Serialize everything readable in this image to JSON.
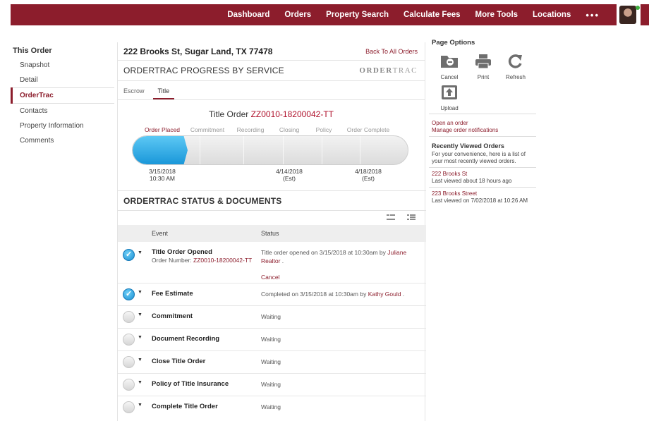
{
  "nav": {
    "items": [
      "Dashboard",
      "Orders",
      "Property Search",
      "Calculate Fees",
      "More Tools",
      "Locations"
    ],
    "more_dots": "•••"
  },
  "sidebar": {
    "title": "This Order",
    "items": [
      {
        "label": "Snapshot",
        "active": false
      },
      {
        "label": "Detail",
        "active": false
      },
      {
        "label": "OrderTrac",
        "active": true
      },
      {
        "label": "Contacts",
        "active": false
      },
      {
        "label": "Property Information",
        "active": false
      },
      {
        "label": "Comments",
        "active": false
      }
    ]
  },
  "main": {
    "address": "222 Brooks St, Sugar Land, TX 77478",
    "back_link": "Back To All Orders",
    "progress_title": "ORDERTRAC PROGRESS BY SERVICE",
    "brand_logo_a": "ORDER",
    "brand_logo_b": "TRAC",
    "tabs": [
      "Escrow",
      "Title"
    ],
    "active_tab": "Title",
    "order_title_prefix": "Title Order ",
    "order_number": "ZZ0010-18200042-TT",
    "stages": [
      "Order Placed",
      "Commitment",
      "Recording",
      "Closing",
      "Policy",
      "Order Complete"
    ],
    "progress_fraction": 0.2,
    "dates": [
      {
        "line1": "3/15/2018",
        "line2": "10:30 AM"
      },
      {
        "line1": "4/14/2018",
        "line2": "(Est)"
      },
      {
        "line1": "4/18/2018",
        "line2": "(Est)"
      }
    ],
    "status_title": "ORDERTRAC STATUS & DOCUMENTS",
    "table": {
      "headers": {
        "event": "Event",
        "status": "Status"
      },
      "rows": [
        {
          "event": "Title Order Opened",
          "sub_label": "Order Number: ",
          "sub_link": "ZZ0010-18200042-TT",
          "status_text": "Title order opened on 3/15/2018 at 10:30am by ",
          "status_link": "Juliane Realtor",
          "status_end": " .",
          "action": "Cancel",
          "done": true
        },
        {
          "event": "Fee Estimate",
          "status_text": "Completed on 3/15/2018 at 10:30am by ",
          "status_link": "Kathy Gould",
          "status_end": " .",
          "done": true
        },
        {
          "event": "Commitment",
          "status_text": "Waiting",
          "done": false
        },
        {
          "event": "Document Recording",
          "status_text": "Waiting",
          "done": false
        },
        {
          "event": "Close Title Order",
          "status_text": "Waiting",
          "done": false
        },
        {
          "event": "Policy of Title Insurance",
          "status_text": "Waiting",
          "done": false
        },
        {
          "event": "Complete Title Order",
          "status_text": "Waiting",
          "done": false
        }
      ]
    }
  },
  "right": {
    "page_options_title": "Page Options",
    "buttons": {
      "cancel": "Cancel",
      "print": "Print",
      "refresh": "Refresh",
      "upload": "Upload"
    },
    "links": [
      "Open an order",
      "Manage order notifications"
    ],
    "recent_title": "Recently Viewed Orders",
    "recent_desc": "For your convenience, here is a list of your most recently viewed orders.",
    "recent": [
      {
        "name": "222 Brooks St",
        "when": "Last viewed about 18 hours ago"
      },
      {
        "name": "223 Brooks Street",
        "when": "Last viewed on 7/02/2018 at 10:26 AM"
      }
    ]
  },
  "colors": {
    "brand": "#8c1d2c",
    "progress": "#1a97d9",
    "order_number": "#b0132d"
  }
}
